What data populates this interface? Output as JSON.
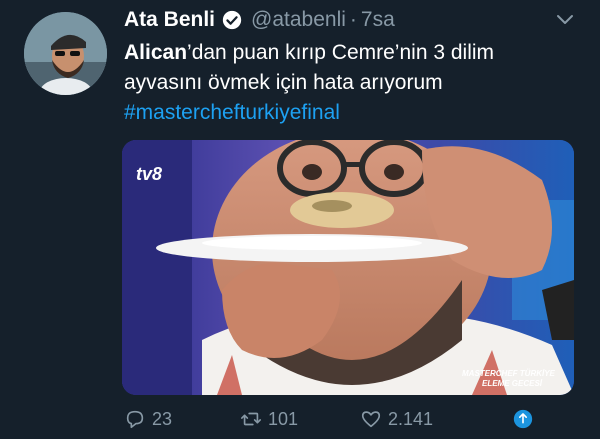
{
  "tweet": {
    "author": {
      "display_name": "Ata Benli",
      "handle": "@atabenli",
      "time": "7sa",
      "verified": true
    },
    "text": {
      "mention": "Alican",
      "line1_rest": "’dan puan kırıp Cemre’nin 3 dilim",
      "line2": "ayvasını övmek için hata arıyorum",
      "hashtag": "#masterchefturkiyefinal"
    },
    "media": {
      "channel_logo": "tv8",
      "watermark_line1": "MASTERCHEF TÜRKİYE",
      "watermark_line2": "ELEME GECESİ"
    },
    "actions": {
      "reply_count": "23",
      "retweet_count": "101",
      "like_count": "2.141"
    }
  },
  "colors": {
    "background": "#15202b",
    "secondary_text": "#8899a6",
    "link": "#1da1f2"
  }
}
